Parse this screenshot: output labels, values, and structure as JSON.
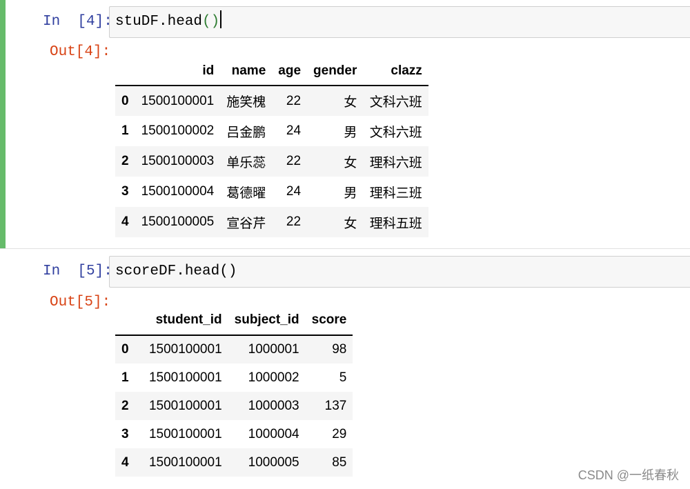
{
  "cells": [
    {
      "in_prompt": "In  [4]:",
      "code_main": "stuDF.head",
      "code_parens": "()",
      "out_prompt": "Out[4]:",
      "table": {
        "columns": [
          "id",
          "name",
          "age",
          "gender",
          "clazz"
        ],
        "rows": [
          {
            "index": "0",
            "values": [
              "1500100001",
              "施笑槐",
              "22",
              "女",
              "文科六班"
            ]
          },
          {
            "index": "1",
            "values": [
              "1500100002",
              "吕金鹏",
              "24",
              "男",
              "文科六班"
            ]
          },
          {
            "index": "2",
            "values": [
              "1500100003",
              "单乐蕊",
              "22",
              "女",
              "理科六班"
            ]
          },
          {
            "index": "3",
            "values": [
              "1500100004",
              "葛德曜",
              "24",
              "男",
              "理科三班"
            ]
          },
          {
            "index": "4",
            "values": [
              "1500100005",
              "宣谷芹",
              "22",
              "女",
              "理科五班"
            ]
          }
        ]
      }
    },
    {
      "in_prompt": "In  [5]:",
      "code_main": "scoreDF.head",
      "code_parens": "()",
      "out_prompt": "Out[5]:",
      "table": {
        "columns": [
          "student_id",
          "subject_id",
          "score"
        ],
        "rows": [
          {
            "index": "0",
            "values": [
              "1500100001",
              "1000001",
              "98"
            ]
          },
          {
            "index": "1",
            "values": [
              "1500100001",
              "1000002",
              "5"
            ]
          },
          {
            "index": "2",
            "values": [
              "1500100001",
              "1000003",
              "137"
            ]
          },
          {
            "index": "3",
            "values": [
              "1500100001",
              "1000004",
              "29"
            ]
          },
          {
            "index": "4",
            "values": [
              "1500100001",
              "1000005",
              "85"
            ]
          }
        ]
      }
    }
  ],
  "watermark": "CSDN @一纸春秋",
  "colors": {
    "selected_cell_bar": "#66bb6a",
    "in_prompt": "#303f9f",
    "out_prompt": "#d84315",
    "matched_paren": "#2e7d32"
  }
}
